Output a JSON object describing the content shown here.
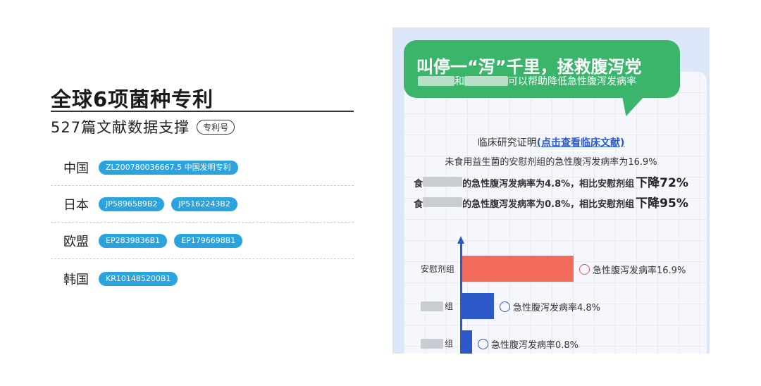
{
  "left": {
    "title": "全球6项菌种专利",
    "subtitle": "527篇文献数据支撑",
    "subtitle_tag": "专利号",
    "countries": [
      {
        "name": "中国",
        "patents": [
          "ZL200780036667.5 中国发明专利"
        ]
      },
      {
        "name": "日本",
        "patents": [
          "JP5896589B2",
          "JP5162243B2"
        ]
      },
      {
        "name": "欧盟",
        "patents": [
          "EP2839836B1",
          "EP1796698B1"
        ]
      },
      {
        "name": "韩国",
        "patents": [
          "KR101485200B1"
        ]
      }
    ]
  },
  "right": {
    "bubble_title": "叫停一“泻”千里，拯救腹泻党",
    "bubble_sub_mid": "和",
    "bubble_sub_end": "可以帮助降低急性腹泻发病率",
    "clinical_prefix": "临床研究证明",
    "clinical_link": "(点击查看临床文献)",
    "placebo_line": "未食用益生菌的安慰剂组的急性腹泻发病率为16.9%",
    "result1_start": "食",
    "result1_mid": "的急性腹泻发病率为4.8%，相比安慰剂组",
    "result1_big": "下降72%",
    "result2_start": "食",
    "result2_mid": "的急性腹泻发病率为0.8%，相比安慰剂组",
    "result2_big": "下降95%"
  },
  "chart_data": {
    "type": "bar",
    "orientation": "horizontal",
    "categories": [
      "安慰剂组",
      "组",
      "组"
    ],
    "values": [
      16.9,
      4.8,
      0.8
    ],
    "value_labels": [
      "急性腹泻发病率16.9%",
      "急性腹泻发病率4.8%",
      "急性腹泻发病率0.8%"
    ],
    "colors": [
      "#f26b5a",
      "#2c58c8",
      "#2c58c8"
    ],
    "icons": [
      "sad-face-icon",
      "smile-face-icon",
      "smile-face-icon"
    ]
  }
}
